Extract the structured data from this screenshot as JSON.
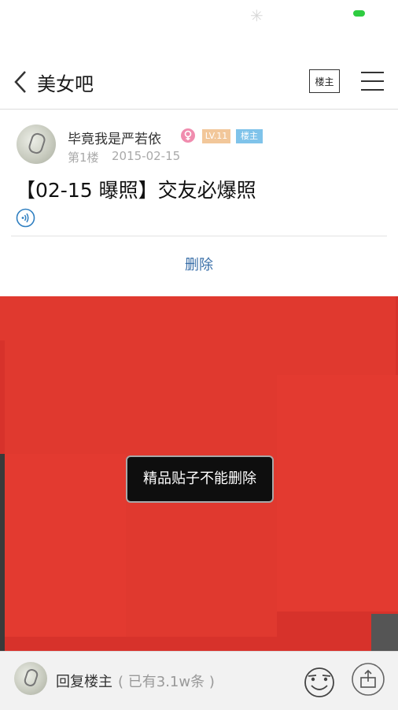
{
  "nav": {
    "title": "美女吧",
    "louzhu_button": "楼主"
  },
  "post": {
    "username": "毕竟我是严若依",
    "level_badge": "LV.11",
    "louzhu_badge": "楼主",
    "floor": "第1楼",
    "date": "2015-02-15",
    "title": "【02-15 曝照】交友必爆照",
    "delete_label": "删除"
  },
  "toast": {
    "message": "精品贴子不能删除"
  },
  "bottom": {
    "reply_label": "回复楼主",
    "reply_count": "( 已有3.1w条 )"
  },
  "colors": {
    "red_mask": "#d7322b",
    "link": "#3a6fa8",
    "status_green": "#2ecc40",
    "lv_badge": "#f2c79a",
    "lz_badge": "#7fc3ea"
  },
  "icons": [
    "back-arrow-icon",
    "menu-icon",
    "female-icon",
    "audio-icon",
    "emoji-icon",
    "share-icon"
  ]
}
